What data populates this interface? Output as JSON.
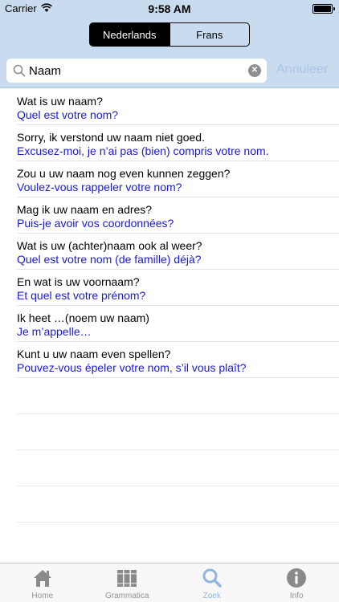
{
  "status_bar": {
    "carrier": "Carrier",
    "time": "9:58 AM"
  },
  "segmented": {
    "options": [
      "Nederlands",
      "Frans"
    ],
    "selected": "Nederlands"
  },
  "search": {
    "value": "Naam",
    "cancel_label": "Annuleer"
  },
  "results": [
    {
      "dutch": "Wat is uw naam?",
      "french": "Quel est votre nom?"
    },
    {
      "dutch": "Sorry, ik verstond uw naam niet goed.",
      "french": "Excusez-moi, je n’ai pas (bien) compris votre nom."
    },
    {
      "dutch": "Zou u uw naam nog even kunnen zeggen?",
      "french": "Voulez-vous rappeler votre nom?"
    },
    {
      "dutch": "Mag ik uw naam en adres?",
      "french": "Puis-je avoir vos coordonnées?"
    },
    {
      "dutch": "Wat is uw (achter)naam ook al weer?",
      "french": "Quel est votre nom (de famille) déjà?"
    },
    {
      "dutch": "En wat is uw voornaam?",
      "french": "Et quel est votre prénom?"
    },
    {
      "dutch": "Ik heet …(noem uw naam)",
      "french": "Je m’appelle…"
    },
    {
      "dutch": "Kunt u uw naam even spellen?",
      "french": "Pouvez-vous épeler votre nom, s’il vous plaît?"
    }
  ],
  "tab_bar": {
    "tabs": [
      {
        "label": "Home",
        "icon": "home-icon"
      },
      {
        "label": "Grammatica",
        "icon": "books-icon"
      },
      {
        "label": "Zoek",
        "icon": "search-icon"
      },
      {
        "label": "Info",
        "icon": "info-icon"
      }
    ],
    "active": "Zoek"
  },
  "colors": {
    "bar_background": "#c9dbee",
    "french_text": "#1a1ad2",
    "active_tab": "#8fb4e3",
    "inactive_tab": "#929292"
  }
}
